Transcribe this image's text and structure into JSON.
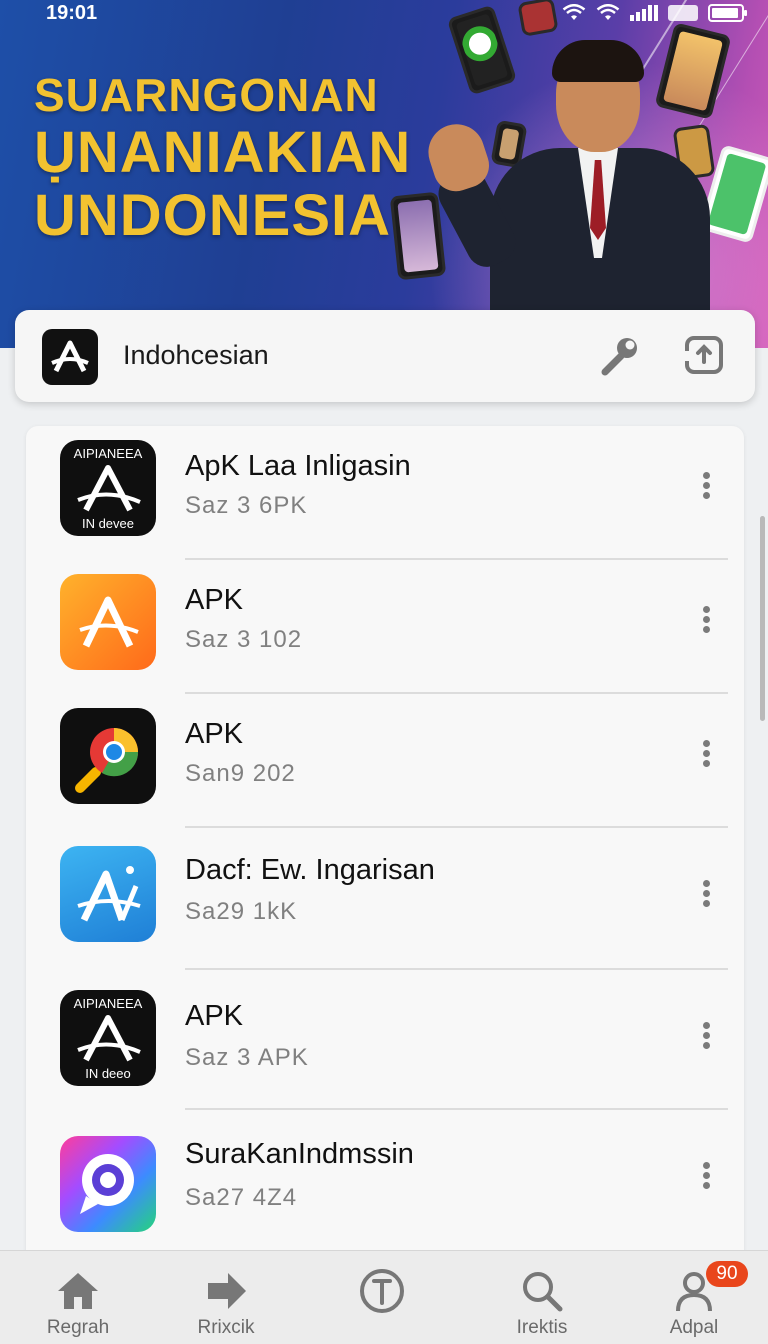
{
  "status_bar": {
    "time": "19:01"
  },
  "banner": {
    "line1": "SUARNGONAN",
    "line2": "ỤNANIAKIAN",
    "line3": "UNDONESIA"
  },
  "search": {
    "text": "Indohcesian"
  },
  "list": [
    {
      "title": "ApK Laa Inligasin",
      "subtitle": "Saz 3  6PK",
      "icon": "black-a-logo-icon",
      "icon_text_top": "AIPIANEEA",
      "icon_text_bottom": "IN devee"
    },
    {
      "title": "APK",
      "subtitle": "Saz 3 102",
      "icon": "orange-a-logo-icon"
    },
    {
      "title": "APK",
      "subtitle": "San9  202",
      "icon": "chrome-p-logo-icon"
    },
    {
      "title": "Dacf: Ew. Ingarisan",
      "subtitle": "Sa29 1kK",
      "icon": "blue-a-logo-icon"
    },
    {
      "title": "APK",
      "subtitle": "Saz 3 APK",
      "icon": "black-a-logo-icon",
      "icon_text_top": "AIPIANEEA",
      "icon_text_bottom": "IN deeo"
    },
    {
      "title": "SuraKanIndmssin",
      "subtitle": "Sa27 4Z4",
      "icon": "gradient-chat-logo-icon"
    }
  ],
  "nav": [
    {
      "label": "Regrah",
      "icon": "home-icon"
    },
    {
      "label": "Rrixcik",
      "icon": "forward-arrow-icon"
    },
    {
      "label": "",
      "icon": "info-circle-icon"
    },
    {
      "label": "Irektis",
      "icon": "search-icon"
    },
    {
      "label": "Adpal",
      "icon": "user-icon",
      "badge": "90"
    }
  ],
  "colors": {
    "accent": "#e9461c",
    "banner_text": "#f2c230",
    "banner_blue": "#1f3f93"
  }
}
